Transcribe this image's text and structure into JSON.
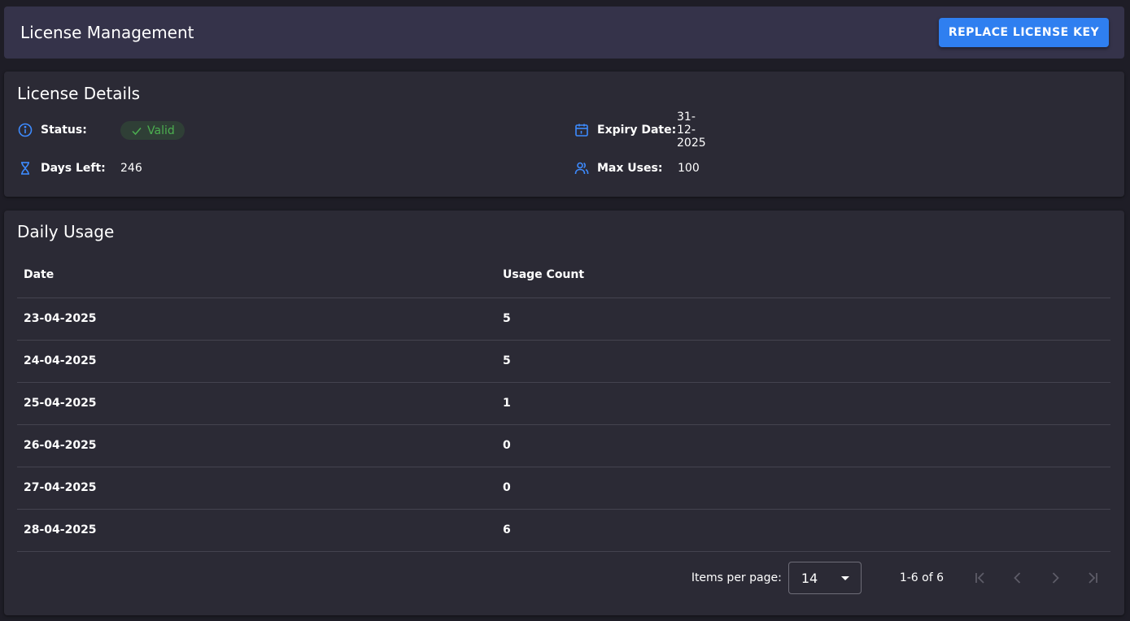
{
  "header": {
    "title": "License Management",
    "replace_button": "REPLACE LICENSE KEY"
  },
  "details": {
    "title": "License Details",
    "status_label": "Status:",
    "status_value": "Valid",
    "days_left_label": "Days Left:",
    "days_left_value": "246",
    "expiry_label": "Expiry Date:",
    "expiry_value": "31-12-2025",
    "max_uses_label": "Max Uses:",
    "max_uses_value": "100"
  },
  "usage": {
    "title": "Daily Usage",
    "columns": [
      "Date",
      "Usage Count"
    ],
    "rows": [
      {
        "date": "23-04-2025",
        "count": "5"
      },
      {
        "date": "24-04-2025",
        "count": "5"
      },
      {
        "date": "25-04-2025",
        "count": "1"
      },
      {
        "date": "26-04-2025",
        "count": "0"
      },
      {
        "date": "27-04-2025",
        "count": "0"
      },
      {
        "date": "28-04-2025",
        "count": "6"
      }
    ]
  },
  "paginator": {
    "items_per_page_label": "Items per page:",
    "items_per_page_value": "14",
    "range_label": "1-6 of 6"
  },
  "colors": {
    "accent": "#2f7ff0",
    "valid": "#4caf50",
    "icon": "#3d8bff"
  }
}
